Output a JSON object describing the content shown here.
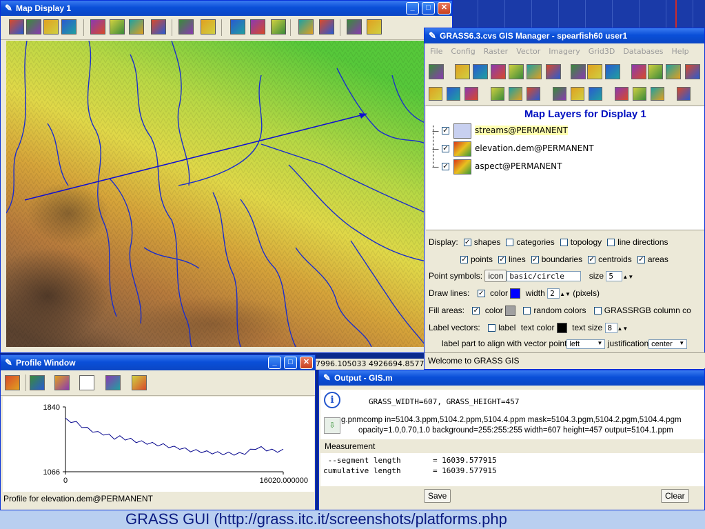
{
  "map_display": {
    "title": "Map Display 1",
    "toolbar_icons": [
      "display-icon",
      "render-icon",
      "overlay-icon",
      "erase-icon",
      "pointer-icon",
      "zoom-in-icon",
      "zoom-out-icon",
      "pan-icon",
      "zoom-back-icon",
      "zoom-menu-icon",
      "query-icon",
      "measure-icon",
      "profile-icon",
      "save-icon",
      "print-icon",
      "nviz-icon",
      "tools-icon"
    ]
  },
  "background_coords": "7996.105033 4926694.8577",
  "gis_manager": {
    "title": "GRASS6.3.cvs GIS Manager - spearfish60 user1",
    "menu": [
      "File",
      "Config",
      "Raster",
      "Vector",
      "Imagery",
      "Grid3D",
      "Databases",
      "Help"
    ],
    "layers_title": "Map Layers for Display 1",
    "layers": [
      {
        "name": "streams@PERMANENT",
        "checked": true,
        "icon": "vector-icon"
      },
      {
        "name": "elevation.dem@PERMANENT",
        "checked": true,
        "icon": "raster-icon"
      },
      {
        "name": "aspect@PERMANENT",
        "checked": true,
        "icon": "raster-icon"
      }
    ],
    "display_label": "Display:",
    "display_opts1": [
      {
        "label": "shapes",
        "checked": true
      },
      {
        "label": "categories",
        "checked": false
      },
      {
        "label": "topology",
        "checked": false
      },
      {
        "label": "line directions",
        "checked": false
      }
    ],
    "display_opts2": [
      {
        "label": "points",
        "checked": true
      },
      {
        "label": "lines",
        "checked": true
      },
      {
        "label": "boundaries",
        "checked": true
      },
      {
        "label": "centroids",
        "checked": true
      },
      {
        "label": "areas",
        "checked": true
      }
    ],
    "point_symbols_label": "Point symbols:",
    "icon_button": "icon",
    "symbol_value": "basic/circle",
    "size_label": "size",
    "size_value": "5",
    "draw_lines_label": "Draw lines:",
    "color_label": "color",
    "line_color": "#0000ff",
    "width_label": "width",
    "width_value": "2",
    "pixels_label": "(pixels)",
    "fill_areas_label": "Fill areas:",
    "fill_color": "#a0a0a0",
    "random_colors_label": "random colors",
    "grassrgb_label": "GRASSRGB column co",
    "label_vectors_label": "Label vectors:",
    "label_label": "label",
    "text_color_label": "text color",
    "text_color": "#000000",
    "text_size_label": "text size",
    "text_size_value": "8",
    "label_part_label": "label part to align with vector point",
    "align_value": "left",
    "justification_label": "justification",
    "justification_value": "center",
    "status": "Welcome to GRASS GIS"
  },
  "profile_window": {
    "title": "Profile Window",
    "status": "Profile for elevation.dem@PERMANENT"
  },
  "chart_data": {
    "type": "line",
    "ylim": [
      1066,
      1840
    ],
    "xlim": [
      0,
      16020
    ],
    "y_tick_labels": [
      "1840",
      "1066"
    ],
    "x_tick_labels": [
      "0",
      "16020.000000"
    ],
    "x": [
      0,
      400,
      800,
      1200,
      1600,
      2000,
      2400,
      2800,
      3200,
      3600,
      4000,
      4400,
      4800,
      5200,
      5600,
      6000,
      6400,
      6800,
      7200,
      7600,
      8000,
      8400,
      8800,
      9200,
      9600,
      10000,
      10400,
      10800,
      11200,
      11600,
      12000,
      12400,
      12800,
      13200,
      13600,
      14000,
      14400,
      14800,
      15200,
      15600,
      16020
    ],
    "y": [
      1690,
      1670,
      1650,
      1610,
      1580,
      1555,
      1530,
      1520,
      1500,
      1470,
      1480,
      1460,
      1450,
      1430,
      1420,
      1410,
      1400,
      1390,
      1385,
      1370,
      1355,
      1350,
      1335,
      1320,
      1315,
      1310,
      1300,
      1295,
      1290,
      1285,
      1285,
      1280,
      1280,
      1290,
      1320,
      1350,
      1350,
      1330,
      1320,
      1315,
      1320
    ],
    "series_color": "#00008b"
  },
  "output_window": {
    "title": "Output - GIS.m",
    "line1": "GRASS_WIDTH=607, GRASS_HEIGHT=457",
    "line2": "g.pnmcomp in=5104.3.ppm,5104.2.ppm,5104.4.ppm mask=5104.3.pgm,5104.2.pgm,5104.4.pgm",
    "line3": "opacity=1.0,0.70,1.0 background=255:255:255 width=607 height=457 output=5104.1.ppm",
    "measurement_label": "Measurement",
    "seg_line": " --segment length       = 16039.577915",
    "cum_line": "cumulative length       = 16039.577915",
    "save_button": "Save",
    "clear_button": "Clear"
  },
  "caption": "GRASS GUI (http://grass.itc.it/screenshots/platforms.php"
}
